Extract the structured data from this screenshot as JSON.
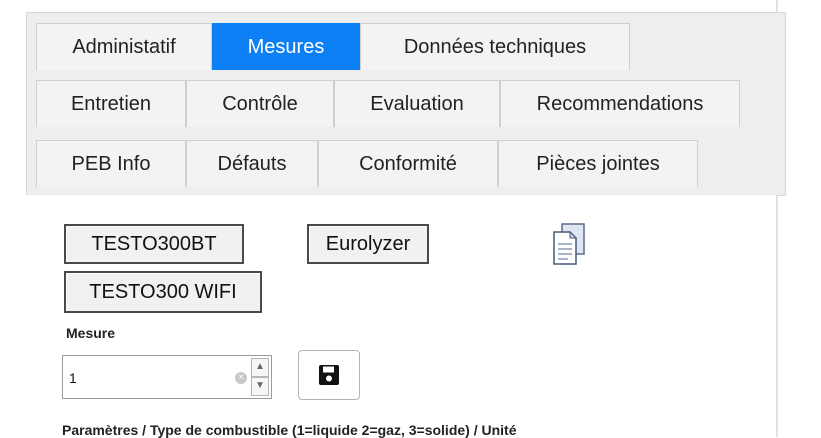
{
  "tabs": {
    "row1": [
      {
        "label": "Administatif"
      },
      {
        "label": "Mesures",
        "active": true
      },
      {
        "label": "Données techniques"
      }
    ],
    "row2": [
      {
        "label": "Entretien"
      },
      {
        "label": "Contrôle"
      },
      {
        "label": "Evaluation"
      },
      {
        "label": "Recommendations"
      }
    ],
    "row3": [
      {
        "label": "PEB Info"
      },
      {
        "label": "Défauts"
      },
      {
        "label": "Conformité"
      },
      {
        "label": "Pièces jointes"
      }
    ]
  },
  "devices": {
    "testo300bt_label": "TESTO300BT",
    "eurolyzer_label": "Eurolyzer",
    "testo300wifi_label": "TESTO300 WIFI"
  },
  "mesure": {
    "label": "Mesure",
    "value": "1"
  },
  "params": {
    "text": "Paramètres / Type de combustible (1=liquide 2=gaz, 3=solide) / Unité"
  },
  "colors": {
    "active_tab": "#0d7ff5",
    "tab_bg": "#f3f3f3",
    "panel_bg": "#eeeeee"
  },
  "icons": {
    "document": "document-copy-icon",
    "save": "floppy-disk-icon",
    "clear": "clear-icon"
  }
}
